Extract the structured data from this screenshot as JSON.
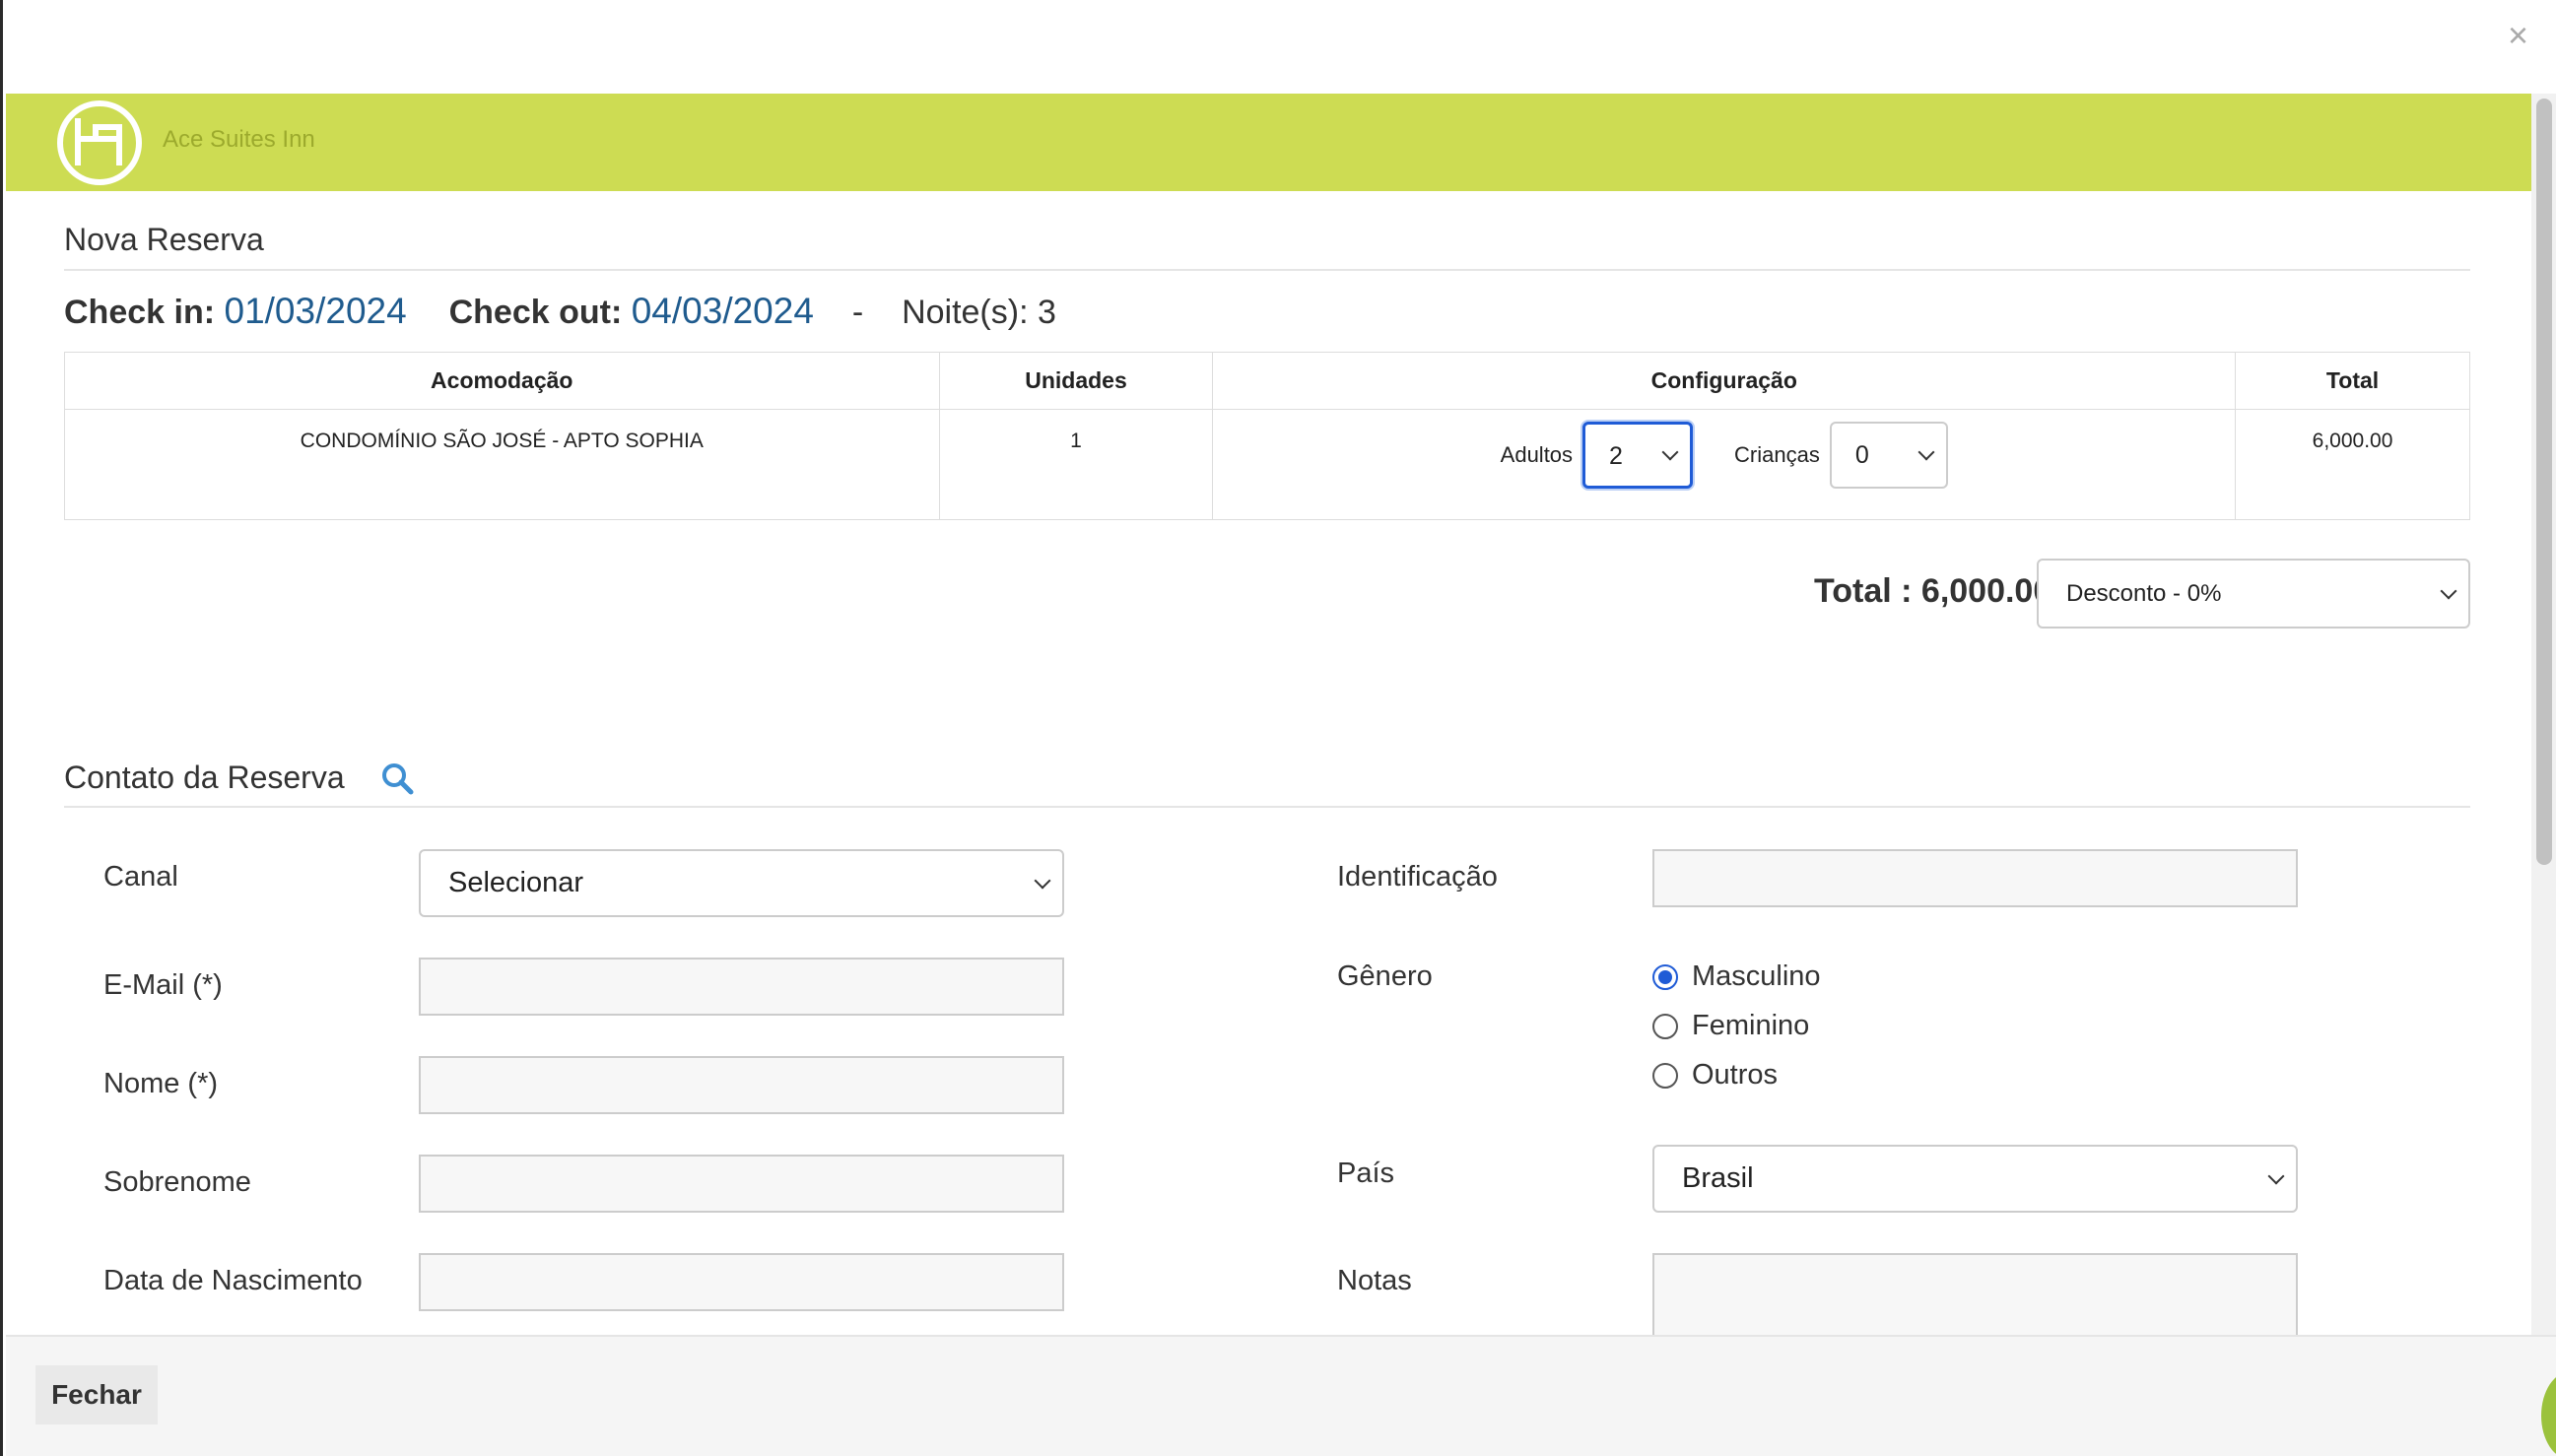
{
  "modal": {
    "close_symbol": "×"
  },
  "hotel": {
    "name": "Ace Suites Inn",
    "brand_color": "#cddc53"
  },
  "reservation": {
    "title": "Nova Reserva",
    "checkin_label": "Check in:",
    "checkin_value": "01/03/2024",
    "checkout_label": "Check out:",
    "checkout_value": "04/03/2024",
    "separator": "-",
    "nights_label": "Noite(s): 3"
  },
  "table": {
    "headers": [
      "Acomodação",
      "Unidades",
      "Configuração",
      "Total"
    ],
    "row": {
      "accommodation": "CONDOMÍNIO SÃO JOSÉ - APTO SOPHIA",
      "units": "1",
      "adults_label": "Adultos",
      "adults_value": "2",
      "children_label": "Crianças",
      "children_value": "0",
      "total": "6,000.00"
    }
  },
  "summary": {
    "total_label": "Total : 6,000.00",
    "discount_value": "Desconto - 0%"
  },
  "contact": {
    "title": "Contato da Reserva",
    "fields": {
      "canal_label": "Canal",
      "canal_value": "Selecionar",
      "email_label": "E-Mail (*)",
      "nome_label": "Nome (*)",
      "sobrenome_label": "Sobrenome",
      "nascimento_label": "Data de Nascimento",
      "identificacao_label": "Identificação",
      "genero_label": "Gênero",
      "genero_options": [
        "Masculino",
        "Feminino",
        "Outros"
      ],
      "genero_selected": "Masculino",
      "pais_label": "País",
      "pais_value": "Brasil",
      "notas_label": "Notas"
    }
  },
  "footer": {
    "close_label": "Fechar"
  },
  "colors": {
    "accent_blue": "#1f5b8e",
    "focus_blue": "#1f5bd6",
    "search_icon": "#3f8fd2"
  }
}
